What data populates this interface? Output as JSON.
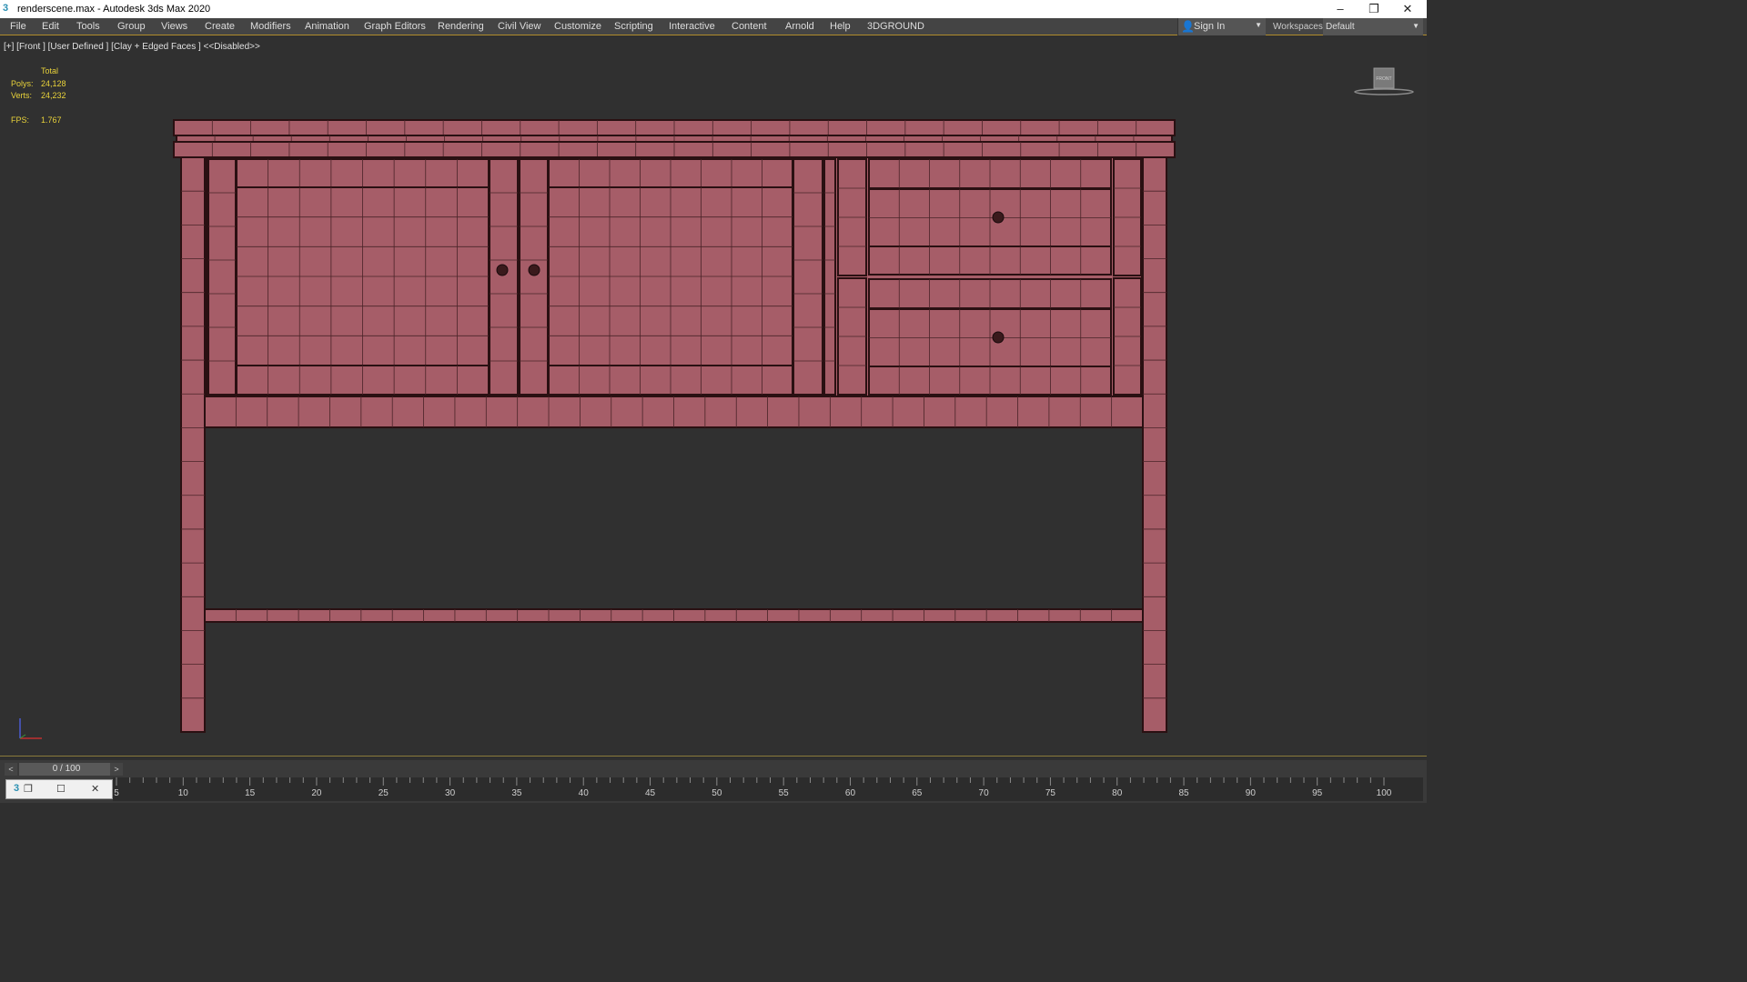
{
  "window": {
    "title": "renderscene.max - Autodesk 3ds Max 2020",
    "icons": [
      "3dsmax-logo-icon",
      "minimize-icon",
      "restore-icon",
      "close-icon"
    ]
  },
  "menu": [
    "File",
    "Edit",
    "Tools",
    "Group",
    "Views",
    "Create",
    "Modifiers",
    "Animation",
    "Graph Editors",
    "Rendering",
    "Civil View",
    "Customize",
    "Scripting",
    "Interactive",
    "Content",
    "Arnold",
    "Help",
    "3DGROUND"
  ],
  "signin": {
    "label": "Sign In"
  },
  "workspaces": {
    "label": "Workspaces:",
    "value": "Default"
  },
  "viewport": {
    "label": "[+] [Front ] [User Defined ] [Clay + Edged Faces ]  <<Disabled>>",
    "viewcube_label": "FRONT"
  },
  "stats": {
    "header": "Total",
    "polys_label": "Polys:",
    "polys": "24,128",
    "verts_label": "Verts:",
    "verts": "24,232",
    "fps_label": "FPS:",
    "fps": "1.767"
  },
  "timeline": {
    "frame": "0 / 100",
    "ticks": [
      "5",
      "10",
      "15",
      "20",
      "25",
      "30",
      "35",
      "40",
      "45",
      "50",
      "55",
      "60",
      "65",
      "70",
      "75",
      "80",
      "85",
      "90",
      "95",
      "100"
    ]
  },
  "colors": {
    "model": "#a65d68",
    "edge": "#2a1012",
    "stats": "#e8d23a",
    "accent": "#b08c2c"
  }
}
